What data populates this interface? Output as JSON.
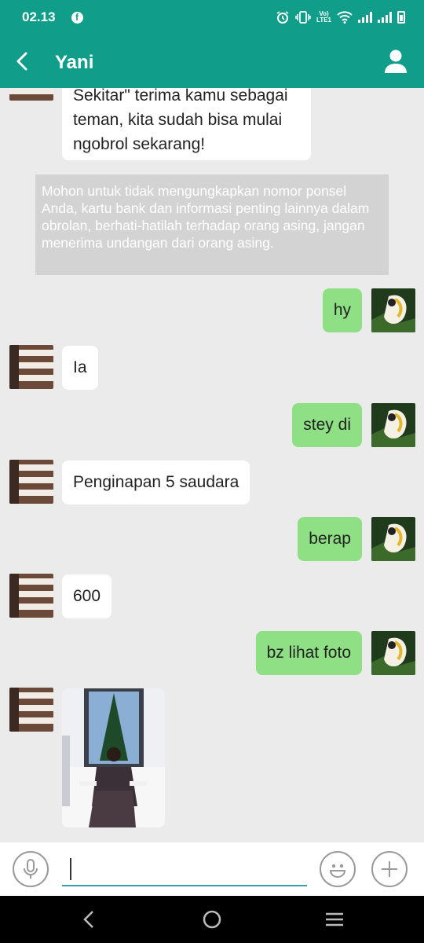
{
  "status_bar": {
    "time": "02.13",
    "icons": [
      "facebook-icon",
      "alarm-icon",
      "vibrate-icon",
      "volte-icon",
      "wifi-icon",
      "signal-icon",
      "signal-icon",
      "battery-icon"
    ],
    "volte_text": "Vo LTE1"
  },
  "header": {
    "title": "Yani",
    "back_icon": "chevron-left-icon",
    "contact_icon": "person-icon",
    "color": "#109e8b"
  },
  "chat": {
    "top_partial_message": "Sekitar\" terima kamu sebagai teman, kita sudah bisa mulai ngobrol sekarang!",
    "top_lines": [
      "Sekitar\" terima kamu sebagai",
      "teman, kita sudah bisa mulai",
      "ngobrol sekarang!"
    ],
    "notice": "Mohon untuk tidak  mengungkapkan nomor ponsel Anda, kartu bank dan informasi penting lainnya dalam obrolan, berhati-hatilah terhadap orang asing, jangan menerima undangan dari orang asing.",
    "messages": [
      {
        "side": "right",
        "text": "hy"
      },
      {
        "side": "left",
        "text": "Ia"
      },
      {
        "side": "right",
        "text": "stey di"
      },
      {
        "side": "left",
        "text": "Penginapan 5 saudara"
      },
      {
        "side": "right",
        "text": "berap"
      },
      {
        "side": "left",
        "text": "600"
      },
      {
        "side": "right",
        "text": "bz lihat foto"
      },
      {
        "side": "left",
        "type": "image",
        "description": "photo"
      }
    ],
    "colors": {
      "sent_bubble": "#8fdf84",
      "received_bubble": "#ffffff",
      "background": "#ebebeb"
    }
  },
  "input_bar": {
    "value": "",
    "placeholder": "",
    "mic_icon": "microphone-icon",
    "emoji_icon": "smiley-icon",
    "plus_icon": "plus-icon"
  },
  "nav_bar": {
    "icons": [
      "back-icon",
      "home-icon",
      "menu-icon"
    ]
  }
}
